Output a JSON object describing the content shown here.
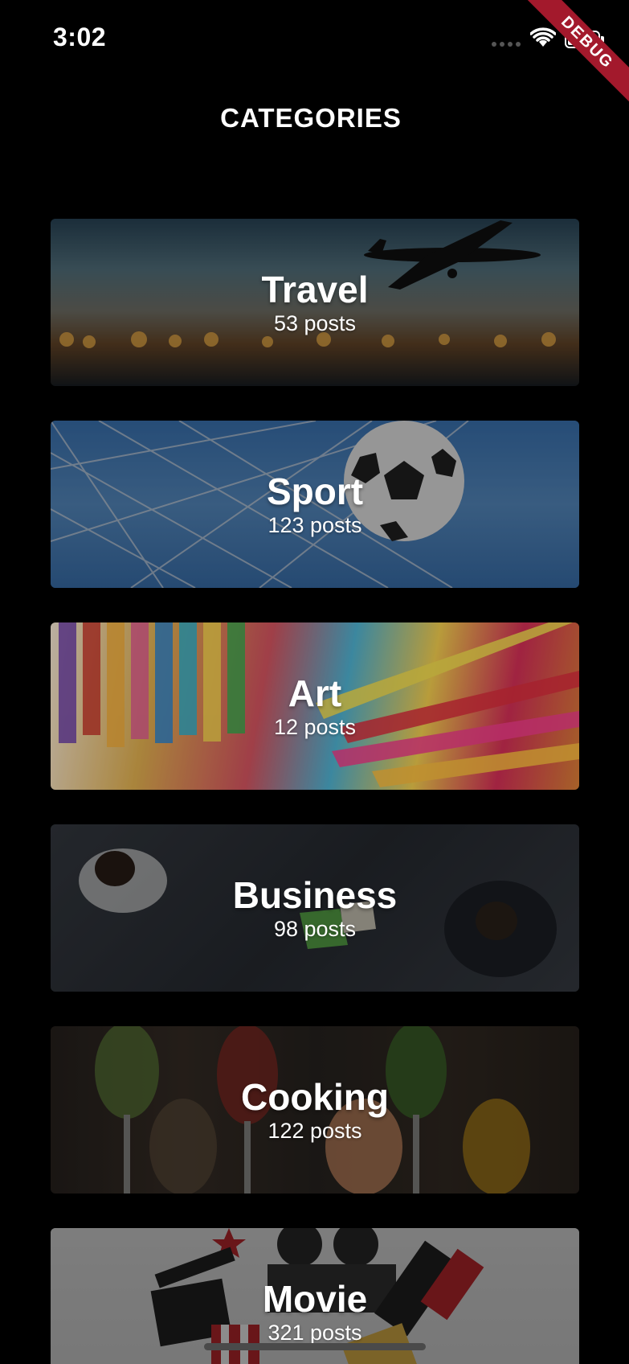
{
  "status_bar": {
    "time": "3:02",
    "icons": [
      "signal-dots-icon",
      "wifi-icon",
      "battery-icon"
    ]
  },
  "debug_banner": "DEBUG",
  "header": {
    "title": "CATEGORIES"
  },
  "categories": [
    {
      "title": "Travel",
      "count": "53 posts"
    },
    {
      "title": "Sport",
      "count": "123 posts"
    },
    {
      "title": "Art",
      "count": "12 posts"
    },
    {
      "title": "Business",
      "count": "98 posts"
    },
    {
      "title": "Cooking",
      "count": "122 posts"
    },
    {
      "title": "Movie",
      "count": "321 posts"
    }
  ],
  "colors": {
    "background": "#000000",
    "debug_banner": "#a3192c",
    "text": "#ffffff"
  }
}
